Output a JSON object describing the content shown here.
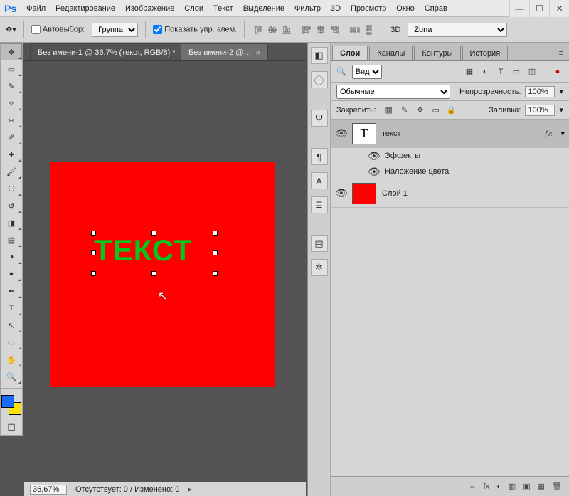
{
  "app": {
    "logo": "Ps"
  },
  "menubar": [
    "Файл",
    "Редактирование",
    "Изображение",
    "Слои",
    "Текст",
    "Выделение",
    "Фильтр",
    "3D",
    "Просмотр",
    "Окно",
    "Справ"
  ],
  "window_controls": {
    "min": "—",
    "max": "☐",
    "close": "✕"
  },
  "optionsbar": {
    "autoselect_label": "Автовыбор:",
    "autoselect_checked": false,
    "group_select": "Группа",
    "show_transform_label": "Показать упр. элем.",
    "show_transform_checked": true,
    "mode_3d": "3D",
    "font_select": "Zuna"
  },
  "tools": [
    {
      "name": "move",
      "glyph": "✥",
      "sel": true
    },
    {
      "name": "marquee",
      "glyph": "▭"
    },
    {
      "name": "lasso",
      "glyph": "✎"
    },
    {
      "name": "wand",
      "glyph": "✧"
    },
    {
      "name": "crop",
      "glyph": "✂"
    },
    {
      "name": "eyedropper",
      "glyph": "✐"
    },
    {
      "name": "heal",
      "glyph": "✚"
    },
    {
      "name": "brush",
      "glyph": "🖌"
    },
    {
      "name": "stamp",
      "glyph": "⎔"
    },
    {
      "name": "history",
      "glyph": "↺"
    },
    {
      "name": "eraser",
      "glyph": "◨"
    },
    {
      "name": "gradient",
      "glyph": "▤"
    },
    {
      "name": "blur",
      "glyph": "◑"
    },
    {
      "name": "dodge",
      "glyph": "●"
    },
    {
      "name": "pen",
      "glyph": "✒"
    },
    {
      "name": "type",
      "glyph": "T"
    },
    {
      "name": "path",
      "glyph": "↖"
    },
    {
      "name": "shape",
      "glyph": "▭"
    },
    {
      "name": "hand",
      "glyph": "✋"
    },
    {
      "name": "zoom",
      "glyph": "🔍"
    }
  ],
  "doctabs": [
    {
      "label": "Без имени-1 @ 36,7% (текст, RGB/8) *",
      "active": true
    },
    {
      "label": "Без имени-2 @…",
      "active": false
    }
  ],
  "canvas": {
    "bg_color": "#ff0000",
    "text_value": "ТЕКСТ",
    "text_color": "#00c81e"
  },
  "right_dock": [
    {
      "name": "color",
      "glyph": "◧"
    },
    {
      "name": "info",
      "glyph": "ⓘ"
    },
    {
      "name": "brushes",
      "glyph": "Ψ"
    },
    {
      "name": "paragraph",
      "glyph": "¶"
    },
    {
      "name": "character",
      "glyph": "A"
    },
    {
      "name": "styles",
      "glyph": "≣"
    },
    {
      "name": "library",
      "glyph": "▤"
    },
    {
      "name": "adjust",
      "glyph": "✲"
    }
  ],
  "panels": {
    "tabs": [
      "Слои",
      "Каналы",
      "Контуры",
      "История"
    ],
    "active_tab": "Слои",
    "layer_filter": {
      "kind_label": "Вид"
    },
    "filter_icons": [
      "▦",
      "◐",
      "T",
      "▭",
      "◫"
    ],
    "blend": {
      "mode": "Обычные",
      "opacity_label": "Непрозрачность:",
      "opacity_value": "100%"
    },
    "lock": {
      "label": "Закрепить:",
      "fill_label": "Заливка:",
      "fill_value": "100%"
    },
    "lock_icons": [
      "▦",
      "✎",
      "✥",
      "▭",
      "🔒"
    ],
    "layers": [
      {
        "kind": "text",
        "name": "текст",
        "thumb": "T",
        "selected": true,
        "has_fx": true,
        "effects_label": "Эффекты",
        "effects": [
          {
            "name": "Наложение цвета"
          }
        ]
      },
      {
        "kind": "pixel",
        "name": "Слой 1",
        "thumb_color": "#ff0000",
        "selected": false
      }
    ],
    "bottom_icons": [
      "⇔",
      "fx",
      "◐",
      "▥",
      "▣",
      "▦",
      "🗑"
    ]
  },
  "statusbar": {
    "zoom": "36,67%",
    "doc_status": "Отсутствует: 0 / Изменено: 0"
  },
  "icons": {
    "search": "🔍",
    "eye": "👁",
    "close": "×",
    "caret": "▸",
    "menu": "≡",
    "dropdown": "▾",
    "dot": "●"
  }
}
